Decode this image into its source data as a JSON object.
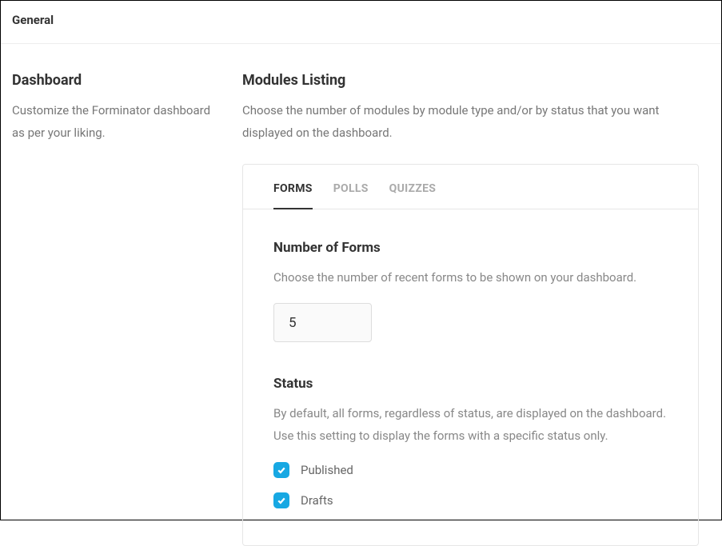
{
  "header": {
    "title": "General"
  },
  "sidebar": {
    "title": "Dashboard",
    "description": "Customize the Forminator dashboard as per your liking."
  },
  "main": {
    "title": "Modules Listing",
    "description": "Choose the number of modules by module type and/or by status that you want displayed on the dashboard.",
    "tabs": [
      {
        "label": "FORMS",
        "active": true
      },
      {
        "label": "POLLS",
        "active": false
      },
      {
        "label": "QUIZZES",
        "active": false
      }
    ],
    "forms": {
      "number_title": "Number of Forms",
      "number_desc": "Choose the number of recent forms to be shown on your dashboard.",
      "number_value": "5",
      "status_title": "Status",
      "status_desc": "By default, all forms, regardless of status, are displayed on the dashboard. Use this setting to display the forms with a specific status only.",
      "status_options": [
        {
          "label": "Published",
          "checked": true
        },
        {
          "label": "Drafts",
          "checked": true
        }
      ]
    }
  },
  "colors": {
    "accent": "#17a8e3"
  }
}
